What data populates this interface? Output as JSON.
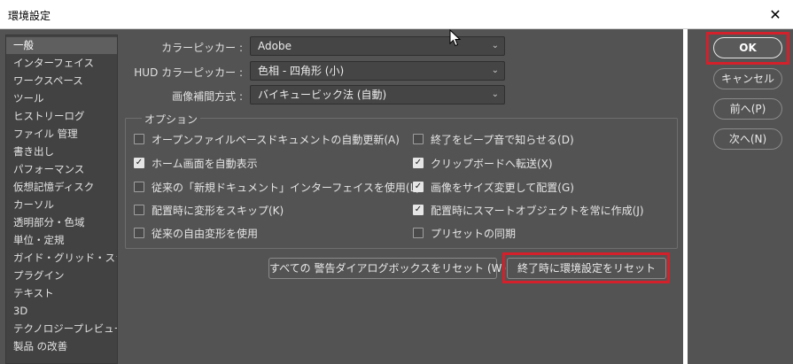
{
  "window": {
    "title": "環境設定",
    "close_icon": "close-icon"
  },
  "sidebar": {
    "items": [
      {
        "label": "一般",
        "selected": true
      },
      {
        "label": "インターフェイス"
      },
      {
        "label": "ワークスペース"
      },
      {
        "label": "ツール"
      },
      {
        "label": "ヒストリーログ"
      },
      {
        "label": "ファイル 管理"
      },
      {
        "label": "書き出し"
      },
      {
        "label": "パフォーマンス"
      },
      {
        "label": "仮想記憶ディスク"
      },
      {
        "label": "カーソル"
      },
      {
        "label": "透明部分・色域"
      },
      {
        "label": "単位・定規"
      },
      {
        "label": "ガイド・グリッド・スライス"
      },
      {
        "label": "プラグイン"
      },
      {
        "label": "テキスト"
      },
      {
        "label": "3D"
      },
      {
        "label": "テクノロジープレビュー"
      },
      {
        "label": "製品 の改善"
      }
    ]
  },
  "general": {
    "color_picker_label": "カラーピッカー :",
    "color_picker_value": "Adobe",
    "hud_picker_label": "HUD カラーピッカー :",
    "hud_picker_value": "色相 - 四角形 (小)",
    "interp_label": "画像補間方式 :",
    "interp_value": "バイキュービック法 (自動)"
  },
  "options": {
    "title": "オプション",
    "left": [
      {
        "label": "オープンファイルベースドキュメントの自動更新(A)",
        "checked": false
      },
      {
        "label": "ホーム画面を自動表示",
        "checked": true
      },
      {
        "label": "従来の「新規ドキュメント」インターフェイスを使用(L)",
        "checked": false
      },
      {
        "label": "配置時に変形をスキップ(K)",
        "checked": false
      },
      {
        "label": "従来の自由変形を使用",
        "checked": false
      }
    ],
    "right": [
      {
        "label": "終了をビープ音で知らせる(D)",
        "checked": false
      },
      {
        "label": "クリップボードへ転送(X)",
        "checked": true
      },
      {
        "label": "画像をサイズ変更して配置(G)",
        "checked": true
      },
      {
        "label": "配置時にスマートオブジェクトを常に作成(J)",
        "checked": true
      },
      {
        "label": "プリセットの同期",
        "checked": false
      }
    ]
  },
  "buttons": {
    "reset_warnings": "すべての 警告ダイアログボックスをリセット (W)",
    "reset_prefs": "終了時に環境設定をリセット",
    "ok": "OK",
    "cancel": "キャンセル",
    "prev": "前へ(P)",
    "next": "次へ(N)"
  },
  "colors": {
    "highlight": "#d3202a",
    "panel": "#535353",
    "sidebar": "#424242"
  }
}
